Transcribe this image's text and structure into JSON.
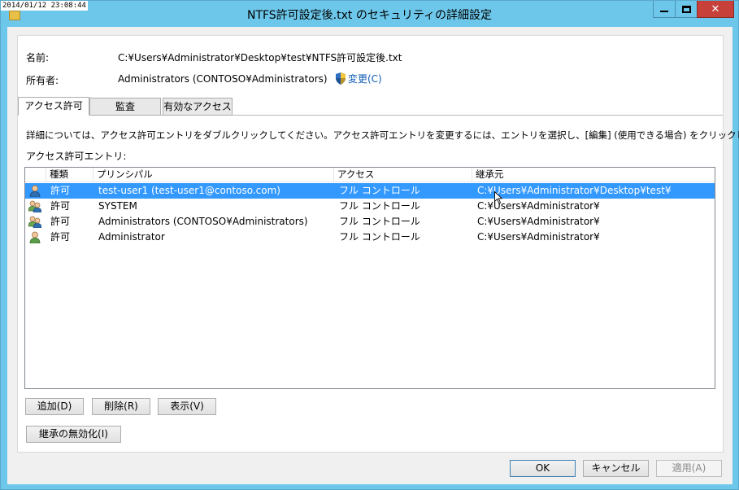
{
  "window": {
    "timestamp": "2014/01/12 23:08:44",
    "title": "NTFS許可設定後.txt のセキュリティの詳細設定"
  },
  "info": {
    "name_label": "名前:",
    "name_value": "C:¥Users¥Administrator¥Desktop¥test¥NTFS許可設定後.txt",
    "owner_label": "所有者:",
    "owner_value": "Administrators (CONTOSO¥Administrators)",
    "change_link": "変更(C)"
  },
  "tabs": [
    {
      "label": "アクセス許可",
      "active": true
    },
    {
      "label": "監査",
      "active": false
    },
    {
      "label": "有効なアクセス",
      "active": false
    }
  ],
  "description": "詳細については、アクセス許可エントリをダブルクリックしてください。アクセス許可エントリを変更するには、エントリを選択し、[編集] (使用できる場合) をクリックします。",
  "entries_label": "アクセス許可エントリ:",
  "columns": [
    "種類",
    "プリンシパル",
    "アクセス",
    "継承元"
  ],
  "entries": [
    {
      "type": "許可",
      "principal": "test-user1 (test-user1@contoso.com)",
      "access": "フル コントロール",
      "inherited": "C:¥Users¥Administrator¥Desktop¥test¥",
      "icon": "user-icon",
      "selected": true
    },
    {
      "type": "許可",
      "principal": "SYSTEM",
      "access": "フル コントロール",
      "inherited": "C:¥Users¥Administrator¥",
      "icon": "group-icon",
      "selected": false
    },
    {
      "type": "許可",
      "principal": "Administrators (CONTOSO¥Administrators)",
      "access": "フル コントロール",
      "inherited": "C:¥Users¥Administrator¥",
      "icon": "group-icon",
      "selected": false
    },
    {
      "type": "許可",
      "principal": "Administrator",
      "access": "フル コントロール",
      "inherited": "C:¥Users¥Administrator¥",
      "icon": "user-icon",
      "selected": false
    }
  ],
  "buttons": {
    "add": "追加(D)",
    "remove": "削除(R)",
    "view": "表示(V)",
    "disable_inheritance": "継承の無効化(I)",
    "ok": "OK",
    "cancel": "キャンセル",
    "apply": "適用(A)"
  },
  "colors": {
    "selection": "#3399ff",
    "link": "#0d5bb5",
    "frame": "#6cc7ea",
    "close": "#c7403a"
  }
}
